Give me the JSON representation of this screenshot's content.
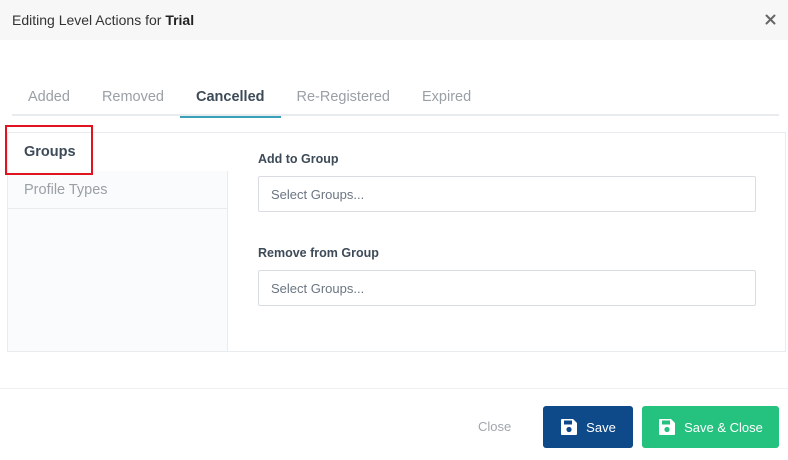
{
  "header": {
    "title_prefix": "Editing Level Actions for ",
    "level_name": "Trial",
    "close_icon": "close-icon"
  },
  "tabs": [
    {
      "label": "Added",
      "active": false
    },
    {
      "label": "Removed",
      "active": false
    },
    {
      "label": "Cancelled",
      "active": true
    },
    {
      "label": "Re-Registered",
      "active": false
    },
    {
      "label": "Expired",
      "active": false
    }
  ],
  "sidebar": {
    "items": [
      {
        "label": "Groups",
        "active": true
      },
      {
        "label": "Profile Types",
        "active": false
      }
    ]
  },
  "form": {
    "add_to_group": {
      "label": "Add to Group",
      "placeholder": "Select Groups..."
    },
    "remove_from_group": {
      "label": "Remove from Group",
      "placeholder": "Select Groups..."
    }
  },
  "footer": {
    "close_label": "Close",
    "save_label": "Save",
    "save_close_label": "Save & Close",
    "save_icon": "floppy-disk-icon"
  },
  "colors": {
    "save_button": "#0e4a8a",
    "save_close_button": "#25c17e",
    "active_tab_underline": "#3aa0b8",
    "highlight_box": "#e0141e"
  }
}
